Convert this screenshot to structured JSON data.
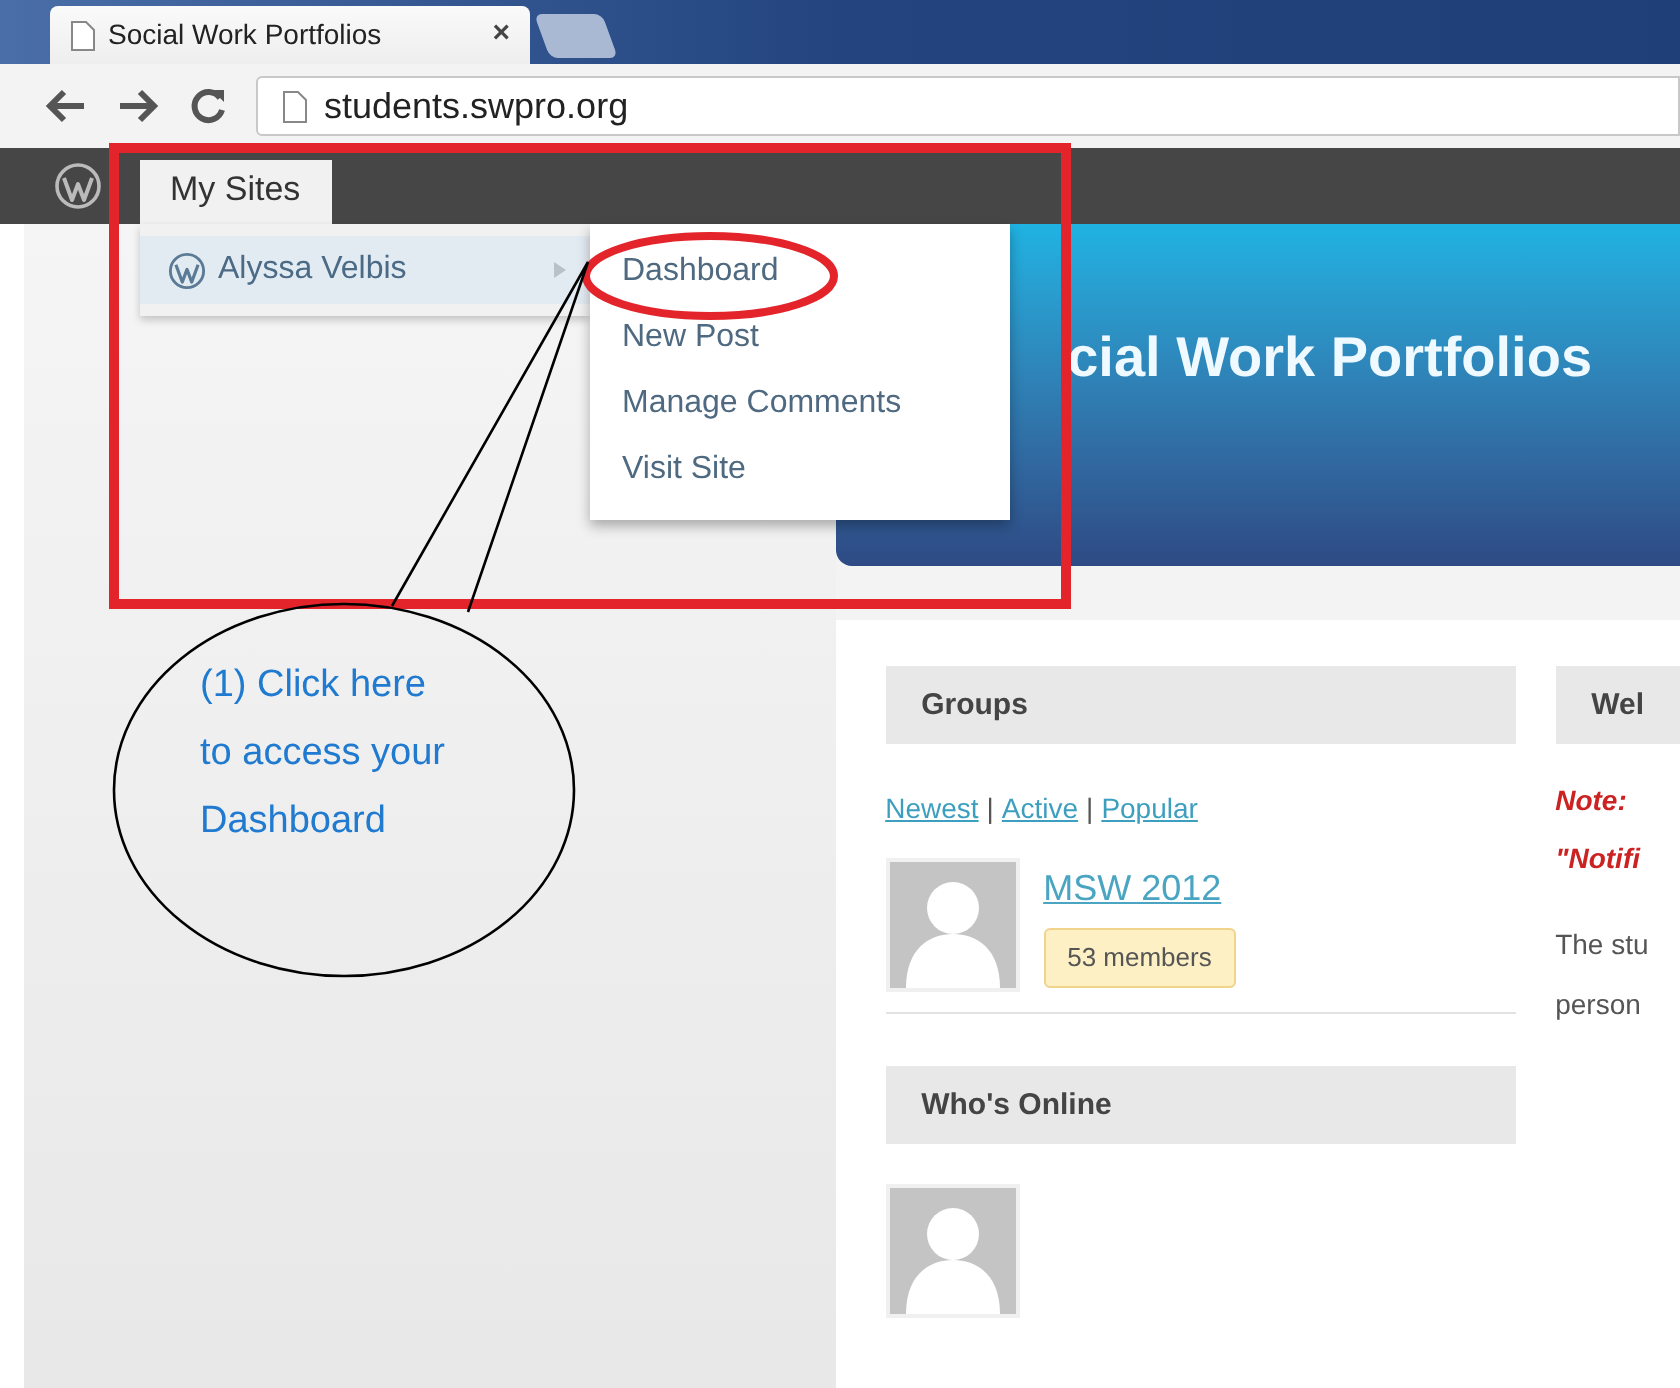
{
  "browser": {
    "tab": {
      "title": "Social Work Portfolios",
      "close": "×"
    },
    "address": "students.swpro.org"
  },
  "admin_bar": {
    "menu": {
      "label": "My Sites",
      "expanded": true
    }
  },
  "sites_menu": {
    "site": {
      "label": "Alyssa Velbis",
      "selected": true
    },
    "submenu": [
      {
        "label": "Dashboard"
      },
      {
        "label": "New Post"
      },
      {
        "label": "Manage Comments"
      },
      {
        "label": "Visit Site"
      }
    ]
  },
  "banner": {
    "title": "cial Work Portfolios"
  },
  "groups": {
    "title": "Groups",
    "separator": "|",
    "filters": [
      "Newest",
      "Active",
      "Popular"
    ],
    "items": [
      {
        "name": "MSW 2012",
        "members": "53 members"
      }
    ]
  },
  "whos_online": {
    "title": "Who's Online"
  },
  "welcome": {
    "title": "Wel",
    "note_lines": [
      "Note:",
      "\"Notifi"
    ],
    "body_lines": [
      "The stu",
      "person"
    ]
  },
  "annotation": {
    "callout": "(1) Click here to access your Dashboard"
  }
}
